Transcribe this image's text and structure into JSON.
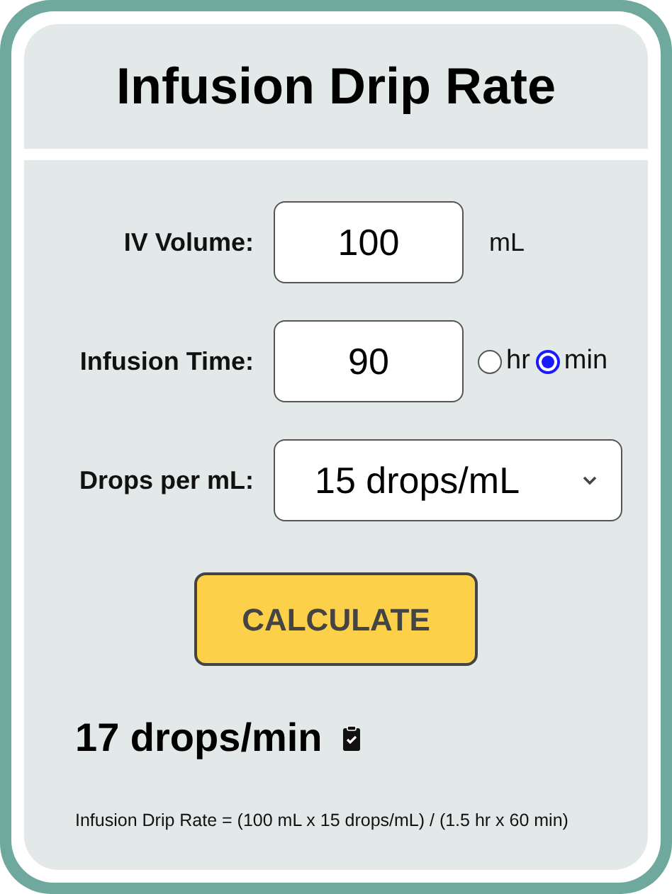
{
  "title": "Infusion Drip Rate",
  "volume": {
    "label": "IV Volume:",
    "value": "100",
    "unit": "mL"
  },
  "time": {
    "label": "Infusion Time:",
    "value": "90",
    "units": [
      {
        "label": "hr",
        "selected": false
      },
      {
        "label": "min",
        "selected": true
      }
    ]
  },
  "drops": {
    "label": "Drops per mL:",
    "value": "15 drops/mL"
  },
  "button": "CALCULATE",
  "result": "17 drops/min",
  "formula": "Infusion Drip Rate = (100 mL x 15 drops/mL) / (1.5 hr x 60 min)"
}
